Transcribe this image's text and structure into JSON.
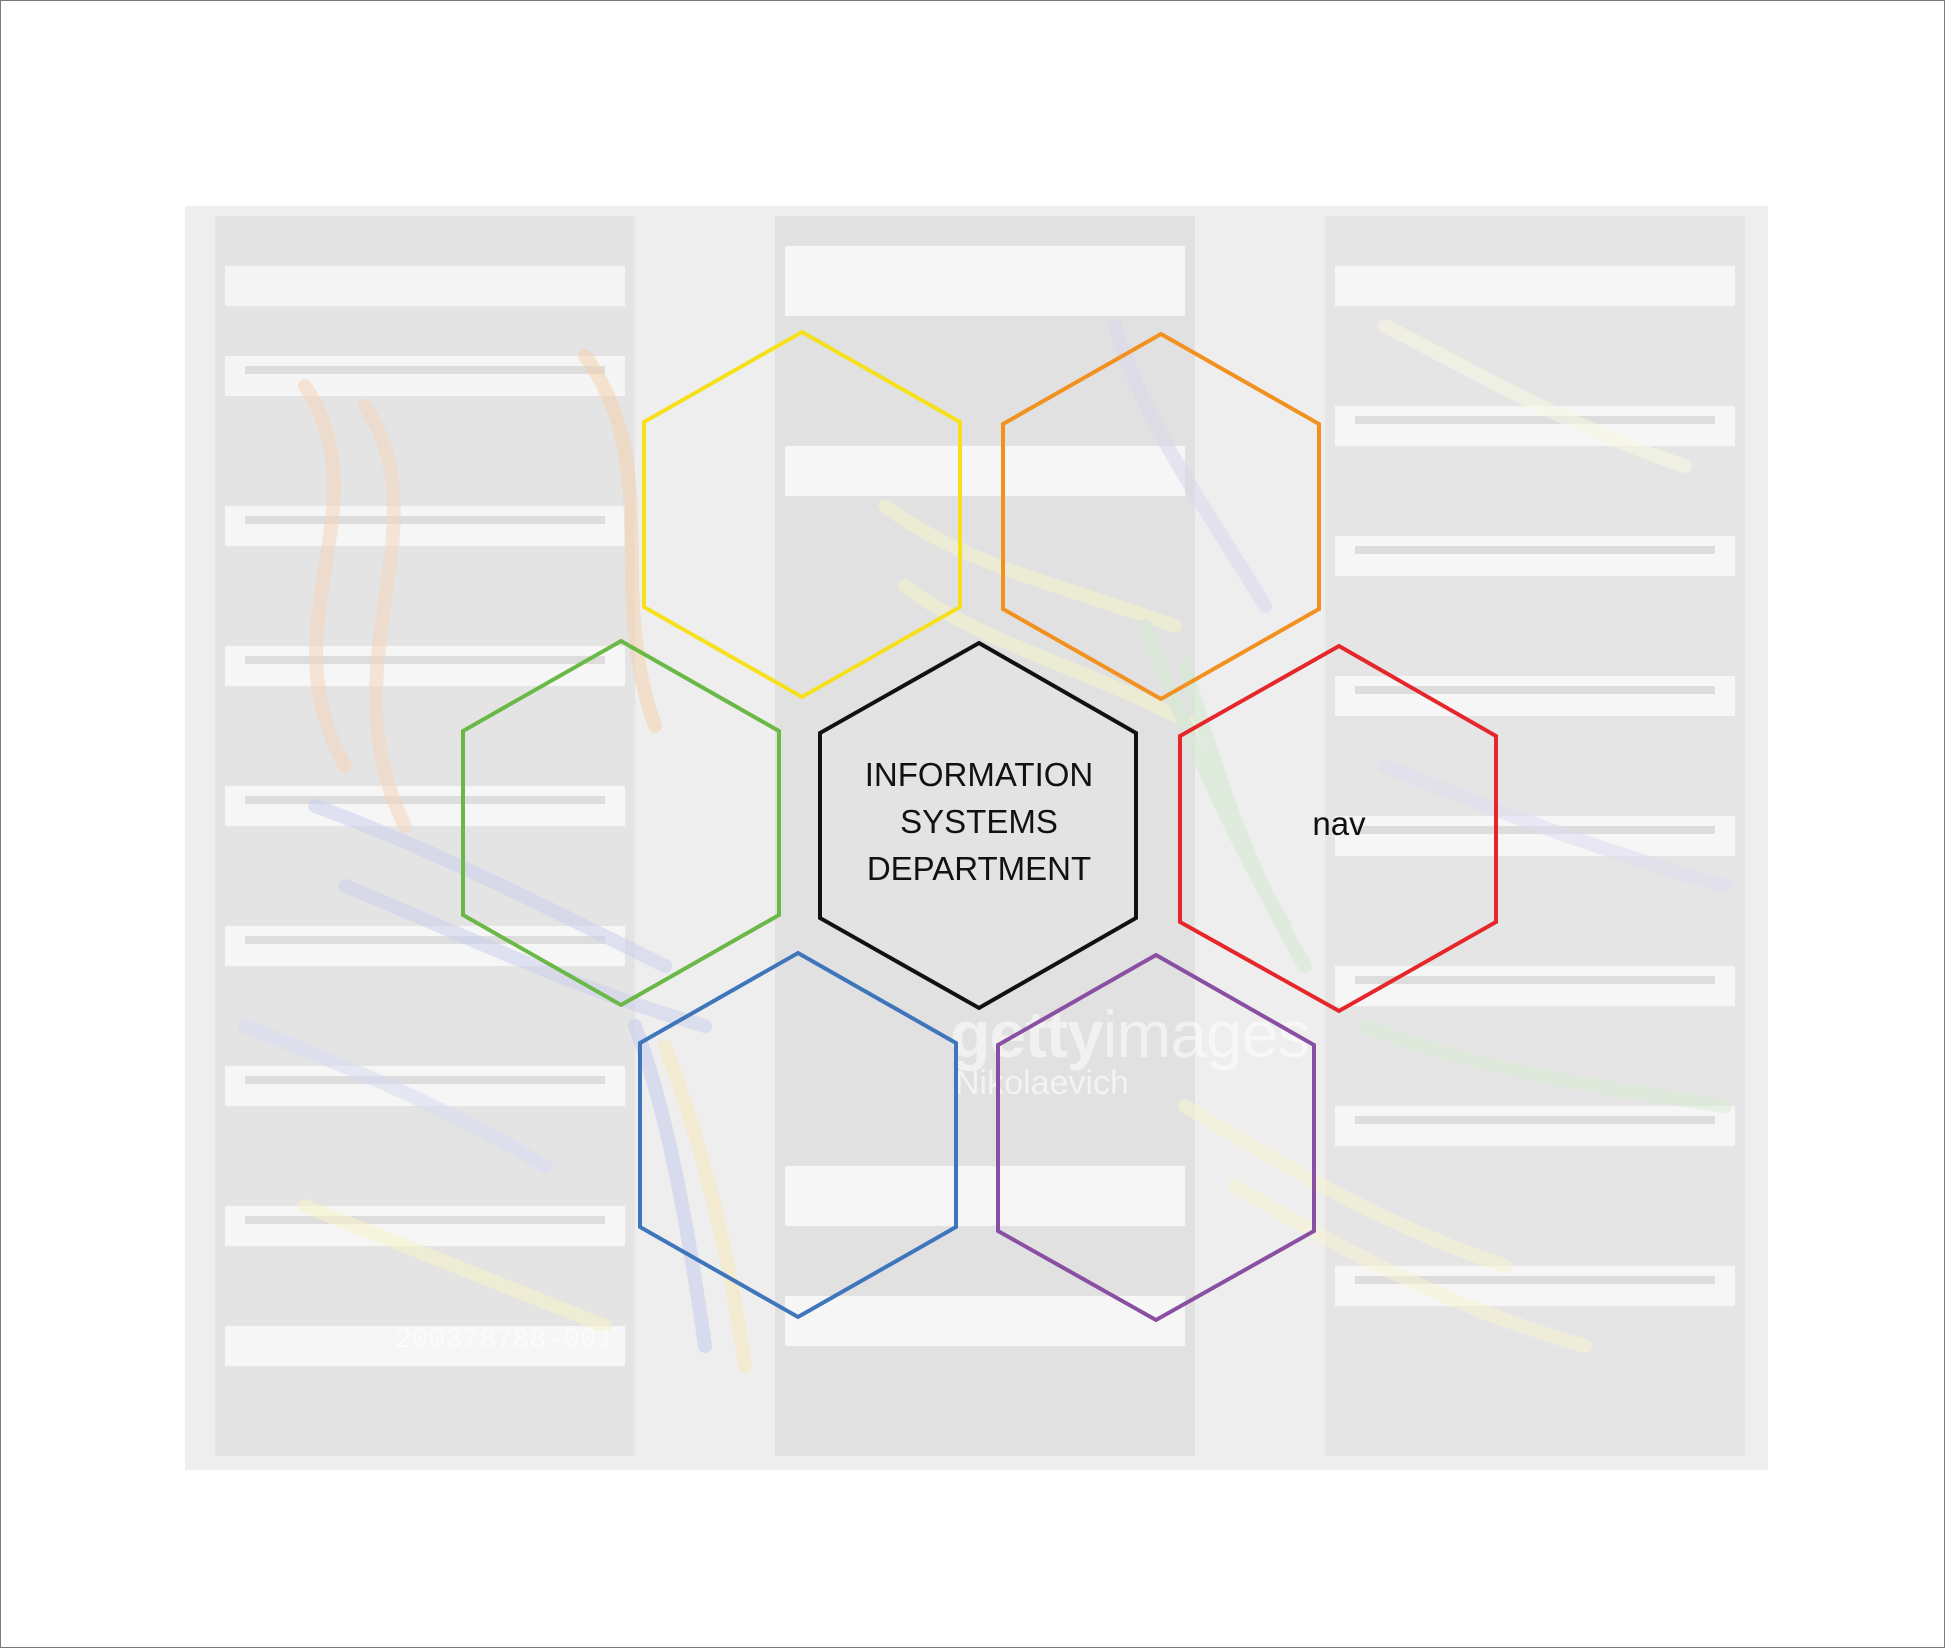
{
  "background": {
    "watermark_bold": "getty",
    "watermark_light": "images",
    "watermark_credit": "Nikolaevich",
    "image_id": "200378788-001"
  },
  "hexagons": [
    {
      "name": "hex-yellow",
      "color": "#f5e01b",
      "label": ""
    },
    {
      "name": "hex-orange",
      "color": "#f39120",
      "label": ""
    },
    {
      "name": "hex-green",
      "color": "#6ab845",
      "label": ""
    },
    {
      "name": "hex-center",
      "color": "#111111",
      "label": "INFORMATION SYSTEMS DEPARTMENT"
    },
    {
      "name": "hex-red",
      "color": "#e5262b",
      "label": "nav"
    },
    {
      "name": "hex-blue",
      "color": "#3e75bb",
      "label": ""
    },
    {
      "name": "hex-purple",
      "color": "#8a4fa3",
      "label": ""
    }
  ],
  "center_label_lines": [
    "INFORMATION",
    "SYSTEMS",
    "DEPARTMENT"
  ],
  "nav_label": "nav"
}
